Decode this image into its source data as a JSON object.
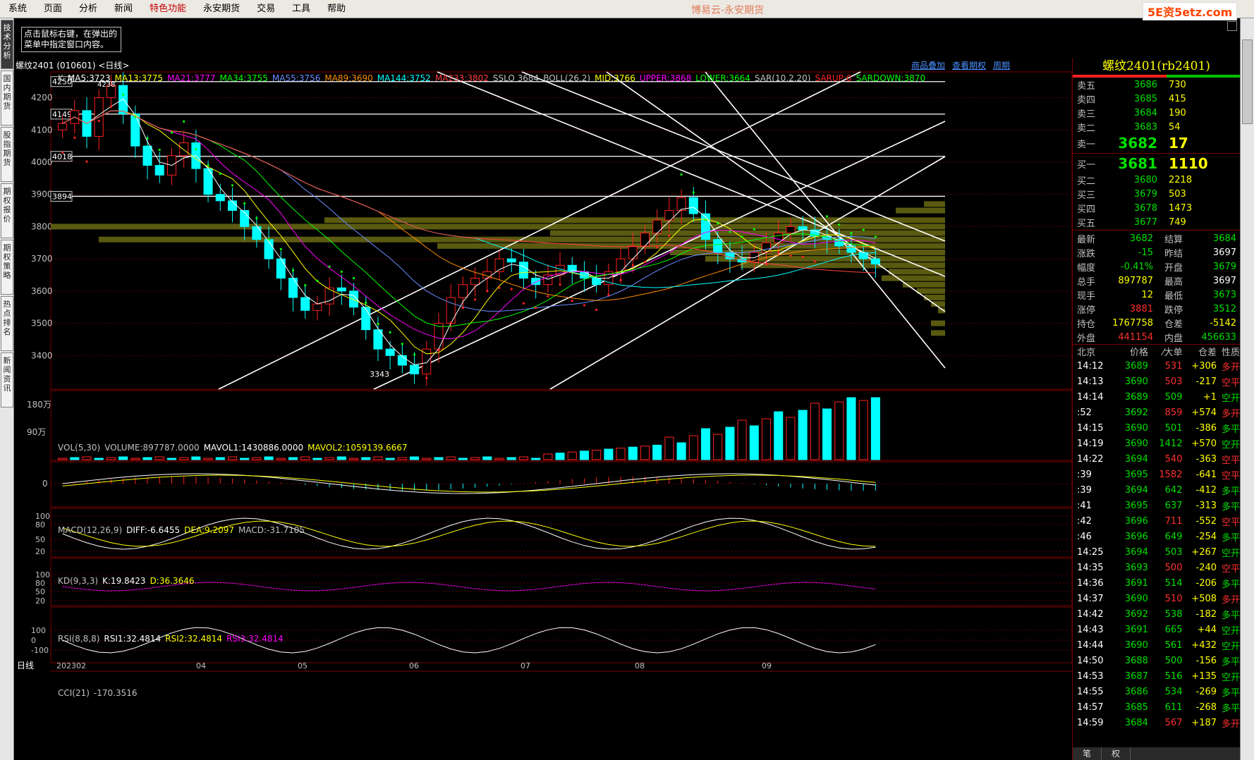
{
  "menu": [
    "系统",
    "页面",
    "分析",
    "新闻",
    "特色功能",
    "永安期货",
    "交易",
    "工具",
    "帮助"
  ],
  "menu_highlight": "特色功能",
  "app_title": "博易云-永安期货",
  "brand": "5E资5etz.com",
  "left_tabs": [
    "技术分析",
    "国内期货",
    "股指期货",
    "期权报价",
    "期权策略",
    "热点排名",
    "新闻资讯"
  ],
  "hint": "点击鼠标右键，在弹出的菜单中指定窗口内容。",
  "symbol_title": "螺纹2401 (010601) <日线>",
  "chart_links": [
    "商品叠加",
    "查看期权",
    "周期"
  ],
  "indicators": {
    "main": [
      {
        "t": "K",
        "c": "#c0c0c0"
      },
      {
        "t": "MA5:3723",
        "c": "#ffffff"
      },
      {
        "t": "MA13:3775",
        "c": "#ffff00"
      },
      {
        "t": "MA21:3777",
        "c": "#ff00ff"
      },
      {
        "t": "MA34:3755",
        "c": "#00ff00"
      },
      {
        "t": "MA55:3756",
        "c": "#6a8cff"
      },
      {
        "t": "MA89:3690",
        "c": "#ff8c00"
      },
      {
        "t": "MA144:3752",
        "c": "#00ffff"
      },
      {
        "t": "MA233:3802",
        "c": "#ff4040"
      },
      {
        "t": "SSLO 3684",
        "c": "#c0c0c0"
      },
      {
        "t": "BOLL(26,2)",
        "c": "#c0c0c0"
      },
      {
        "t": "MID:3766",
        "c": "#ffff00"
      },
      {
        "t": "UPPER:3868",
        "c": "#ff00ff"
      },
      {
        "t": "LOWER:3664",
        "c": "#00ff00"
      },
      {
        "t": "SAR(10,2,20)",
        "c": "#c0c0c0"
      },
      {
        "t": "SARUP:0",
        "c": "#ff2020"
      },
      {
        "t": "SARDOWN:3870",
        "c": "#00ff00"
      }
    ],
    "vol": [
      {
        "t": "VOL(5,30)",
        "c": "#c0c0c0"
      },
      {
        "t": "VOLUME:897787.0000",
        "c": "#c0c0c0"
      },
      {
        "t": "MAVOL1:1430886.0000",
        "c": "#ffffff"
      },
      {
        "t": "MAVOL2:1059139.6667",
        "c": "#ffff00"
      }
    ],
    "macd": [
      {
        "t": "MACD(12,26,9)",
        "c": "#c0c0c0"
      },
      {
        "t": "DIFF:-6.6455",
        "c": "#ffffff"
      },
      {
        "t": "DEA:9.2097",
        "c": "#ffff00"
      },
      {
        "t": "MACD:-31.7105",
        "c": "#c0c0c0"
      }
    ],
    "kd": [
      {
        "t": "KD(9,3,3)",
        "c": "#c0c0c0"
      },
      {
        "t": "K:19.8423",
        "c": "#ffffff"
      },
      {
        "t": "D:36.3646",
        "c": "#ffff00"
      }
    ],
    "rsi": [
      {
        "t": "RSI(8,8,8)",
        "c": "#c0c0c0"
      },
      {
        "t": "RSI1:32.4814",
        "c": "#ffffff"
      },
      {
        "t": "RSI2:32.4814",
        "c": "#ffff00"
      },
      {
        "t": "RSI3:32.4814",
        "c": "#ff00ff"
      }
    ],
    "cci": [
      {
        "t": "CCI(21)",
        "c": "#c0c0c0"
      },
      {
        "t": "-170.3516",
        "c": "#c0c0c0"
      }
    ]
  },
  "price_labels": [
    "4200",
    "4100",
    "4000",
    "3900",
    "3800",
    "3700",
    "3600",
    "3500",
    "3400"
  ],
  "boxed_levels": [
    "4250",
    "4149",
    "4018",
    "3894"
  ],
  "peak_label": "4238",
  "low_label": "3343",
  "vol_labels": [
    "180万",
    "90万"
  ],
  "macd_labels": [
    "0"
  ],
  "kd_labels": [
    "100",
    "80",
    "50",
    "20"
  ],
  "rsi_labels": [
    "100",
    "80",
    "50",
    "20"
  ],
  "cci_labels": [
    "100",
    "0",
    "-100"
  ],
  "x_labels": [
    "202302",
    "04",
    "05",
    "06",
    "07",
    "08",
    "09"
  ],
  "period_label": "日线",
  "chart_data": {
    "type": "candlestick",
    "y_range": [
      3300,
      4280
    ],
    "close_series": [
      4120,
      4160,
      4080,
      4200,
      4238,
      4150,
      4050,
      3990,
      3960,
      4020,
      4060,
      3980,
      3900,
      3880,
      3850,
      3800,
      3760,
      3700,
      3640,
      3580,
      3540,
      3560,
      3610,
      3600,
      3550,
      3480,
      3420,
      3400,
      3370,
      3343,
      3420,
      3500,
      3580,
      3620,
      3640,
      3660,
      3700,
      3690,
      3640,
      3620,
      3650,
      3680,
      3660,
      3640,
      3620,
      3660,
      3700,
      3740,
      3780,
      3820,
      3850,
      3890,
      3840,
      3760,
      3720,
      3700,
      3690,
      3720,
      3750,
      3780,
      3800,
      3790,
      3770,
      3760,
      3740,
      3720,
      3700,
      3684
    ],
    "volume_note": "volume rises sharply in final months"
  },
  "orderbook": {
    "title": "螺纹2401(rb2401)",
    "asks": [
      {
        "label": "卖五",
        "price": "3686",
        "vol": "730"
      },
      {
        "label": "卖四",
        "price": "3685",
        "vol": "415"
      },
      {
        "label": "卖三",
        "price": "3684",
        "vol": "190"
      },
      {
        "label": "卖二",
        "price": "3683",
        "vol": "54"
      },
      {
        "label": "卖一",
        "price": "3682",
        "vol": "17"
      }
    ],
    "bids": [
      {
        "label": "买一",
        "price": "3681",
        "vol": "1110"
      },
      {
        "label": "买二",
        "price": "3680",
        "vol": "2218"
      },
      {
        "label": "买三",
        "price": "3679",
        "vol": "503"
      },
      {
        "label": "买四",
        "price": "3678",
        "vol": "1473"
      },
      {
        "label": "买五",
        "price": "3677",
        "vol": "749"
      }
    ]
  },
  "quote": [
    {
      "k1": "最新",
      "v1": "3682",
      "c1": "#00e000",
      "k2": "结算",
      "v2": "3684",
      "c2": "#00e000"
    },
    {
      "k1": "涨跌",
      "v1": "-15",
      "c1": "#00e000",
      "k2": "昨结",
      "v2": "3697",
      "c2": "#ffffff"
    },
    {
      "k1": "幅度",
      "v1": "-0.41%",
      "c1": "#00e000",
      "k2": "开盘",
      "v2": "3679",
      "c2": "#00e000"
    },
    {
      "k1": "总手",
      "v1": "897787",
      "c1": "#ffff00",
      "k2": "最高",
      "v2": "3697",
      "c2": "#ffffff"
    },
    {
      "k1": "现手",
      "v1": "12",
      "c1": "#ffff00",
      "k2": "最低",
      "v2": "3673",
      "c2": "#00e000"
    },
    {
      "k1": "涨停",
      "v1": "3881",
      "c1": "#ff3030",
      "k2": "跌停",
      "v2": "3512",
      "c2": "#00e000"
    },
    {
      "k1": "持仓",
      "v1": "1767758",
      "c1": "#ffff00",
      "k2": "仓差",
      "v2": "-5142",
      "c2": "#ffff00"
    },
    {
      "k1": "外盘",
      "v1": "441154",
      "c1": "#ff3030",
      "k2": "内盘",
      "v2": "456633",
      "c2": "#00e000"
    }
  ],
  "ticks_header": [
    "北京",
    "价格",
    "⁄大单",
    "仓差",
    "性质"
  ],
  "ticks": [
    {
      "t": "14:12",
      "p": "3689",
      "v": "531",
      "vc": "#ff3030",
      "d": "+306",
      "ty": "多开",
      "tc": "#ff3030"
    },
    {
      "t": "14:13",
      "p": "3690",
      "v": "503",
      "vc": "#ff3030",
      "d": "-217",
      "ty": "空平",
      "tc": "#ff3030"
    },
    {
      "t": "14:14",
      "p": "3689",
      "v": "509",
      "vc": "#00e000",
      "d": "+1",
      "ty": "空开",
      "tc": "#00e000"
    },
    {
      "t": ":52",
      "p": "3692",
      "v": "859",
      "vc": "#ff3030",
      "d": "+574",
      "ty": "多开",
      "tc": "#ff3030"
    },
    {
      "t": "14:15",
      "p": "3690",
      "v": "501",
      "vc": "#00e000",
      "d": "-386",
      "ty": "多平",
      "tc": "#00e000"
    },
    {
      "t": "14:19",
      "p": "3690",
      "v": "1412",
      "vc": "#00e000",
      "d": "+570",
      "ty": "空开",
      "tc": "#00e000"
    },
    {
      "t": "14:22",
      "p": "3694",
      "v": "540",
      "vc": "#ff3030",
      "d": "-363",
      "ty": "空平",
      "tc": "#ff3030"
    },
    {
      "t": ":39",
      "p": "3695",
      "v": "1582",
      "vc": "#ff3030",
      "d": "-641",
      "ty": "空平",
      "tc": "#ff3030"
    },
    {
      "t": ":39",
      "p": "3694",
      "v": "642",
      "vc": "#00e000",
      "d": "-412",
      "ty": "多平",
      "tc": "#00e000"
    },
    {
      "t": ":41",
      "p": "3695",
      "v": "637",
      "vc": "#00e000",
      "d": "-313",
      "ty": "多平",
      "tc": "#00e000"
    },
    {
      "t": ":42",
      "p": "3696",
      "v": "711",
      "vc": "#ff3030",
      "d": "-552",
      "ty": "空平",
      "tc": "#ff3030"
    },
    {
      "t": ":46",
      "p": "3696",
      "v": "649",
      "vc": "#00e000",
      "d": "-254",
      "ty": "多平",
      "tc": "#00e000"
    },
    {
      "t": "14:25",
      "p": "3694",
      "v": "503",
      "vc": "#00e000",
      "d": "+267",
      "ty": "空开",
      "tc": "#00e000"
    },
    {
      "t": "14:35",
      "p": "3693",
      "v": "500",
      "vc": "#ff3030",
      "d": "-240",
      "ty": "空平",
      "tc": "#ff3030"
    },
    {
      "t": "14:36",
      "p": "3691",
      "v": "514",
      "vc": "#00e000",
      "d": "-206",
      "ty": "多平",
      "tc": "#00e000"
    },
    {
      "t": "14:37",
      "p": "3690",
      "v": "510",
      "vc": "#ff3030",
      "d": "+508",
      "ty": "多开",
      "tc": "#ff3030"
    },
    {
      "t": "14:42",
      "p": "3692",
      "v": "538",
      "vc": "#00e000",
      "d": "-182",
      "ty": "多平",
      "tc": "#00e000"
    },
    {
      "t": "14:43",
      "p": "3691",
      "v": "665",
      "vc": "#00e000",
      "d": "+44",
      "ty": "空开",
      "tc": "#00e000"
    },
    {
      "t": "14:44",
      "p": "3690",
      "v": "561",
      "vc": "#00e000",
      "d": "+432",
      "ty": "空开",
      "tc": "#00e000"
    },
    {
      "t": "14:50",
      "p": "3688",
      "v": "500",
      "vc": "#00e000",
      "d": "-156",
      "ty": "多平",
      "tc": "#00e000"
    },
    {
      "t": "14:53",
      "p": "3687",
      "v": "516",
      "vc": "#00e000",
      "d": "+135",
      "ty": "空开",
      "tc": "#00e000"
    },
    {
      "t": "14:55",
      "p": "3686",
      "v": "534",
      "vc": "#00e000",
      "d": "-269",
      "ty": "多平",
      "tc": "#00e000"
    },
    {
      "t": "14:57",
      "p": "3685",
      "v": "611",
      "vc": "#00e000",
      "d": "-268",
      "ty": "多平",
      "tc": "#00e000"
    },
    {
      "t": "14:59",
      "p": "3684",
      "v": "567",
      "vc": "#ff3030",
      "d": "+187",
      "ty": "多开",
      "tc": "#ff3030"
    }
  ],
  "rp_tabs": [
    "笔",
    "权"
  ]
}
